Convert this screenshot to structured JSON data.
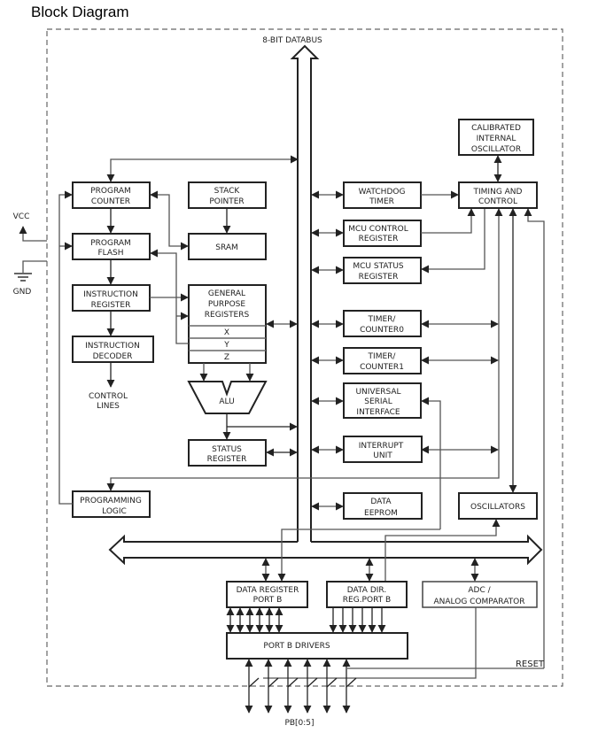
{
  "title": "Block Diagram",
  "labels": {
    "databus": "8-BIT DATABUS",
    "vcc": "VCC",
    "gnd": "GND",
    "control_lines": [
      "CONTROL",
      "LINES"
    ],
    "reset": "RESET",
    "pins": "PB[0:5]"
  },
  "blocks": {
    "program_counter": [
      "PROGRAM",
      "COUNTER"
    ],
    "stack_pointer": [
      "STACK",
      "POINTER"
    ],
    "program_flash": [
      "PROGRAM",
      "FLASH"
    ],
    "sram": [
      "SRAM"
    ],
    "instruction_register": [
      "INSTRUCTION",
      "REGISTER"
    ],
    "gpr": [
      "GENERAL",
      "PURPOSE",
      "REGISTERS"
    ],
    "gpr_x": "X",
    "gpr_y": "Y",
    "gpr_z": "Z",
    "instruction_decoder": [
      "INSTRUCTION",
      "DECODER"
    ],
    "alu": "ALU",
    "status_register": [
      "STATUS",
      "REGISTER"
    ],
    "programming_logic": [
      "PROGRAMMING",
      "LOGIC"
    ],
    "calibrated_osc": [
      "CALIBRATED",
      "INTERNAL",
      "OSCILLATOR"
    ],
    "watchdog": [
      "WATCHDOG",
      "TIMER"
    ],
    "timing_control": [
      "TIMING AND",
      "CONTROL"
    ],
    "mcu_control": [
      "MCU CONTROL",
      "REGISTER"
    ],
    "mcu_status": [
      "MCU STATUS",
      "REGISTER"
    ],
    "timer0": [
      "TIMER/",
      "COUNTER0"
    ],
    "timer1": [
      "TIMER/",
      "COUNTER1"
    ],
    "usi": [
      "UNIVERSAL",
      "SERIAL",
      "INTERFACE"
    ],
    "interrupt": [
      "INTERRUPT",
      "UNIT"
    ],
    "eeprom": [
      "DATA",
      "EEPROM"
    ],
    "oscillators": [
      "OSCILLATORS"
    ],
    "data_reg_portb": [
      "DATA REGISTER",
      "PORT B"
    ],
    "data_dir_portb": [
      "DATA DIR.",
      "REG.PORT B"
    ],
    "adc": [
      "ADC /",
      "ANALOG COMPARATOR"
    ],
    "portb_drivers": [
      "PORT B DRIVERS"
    ]
  }
}
